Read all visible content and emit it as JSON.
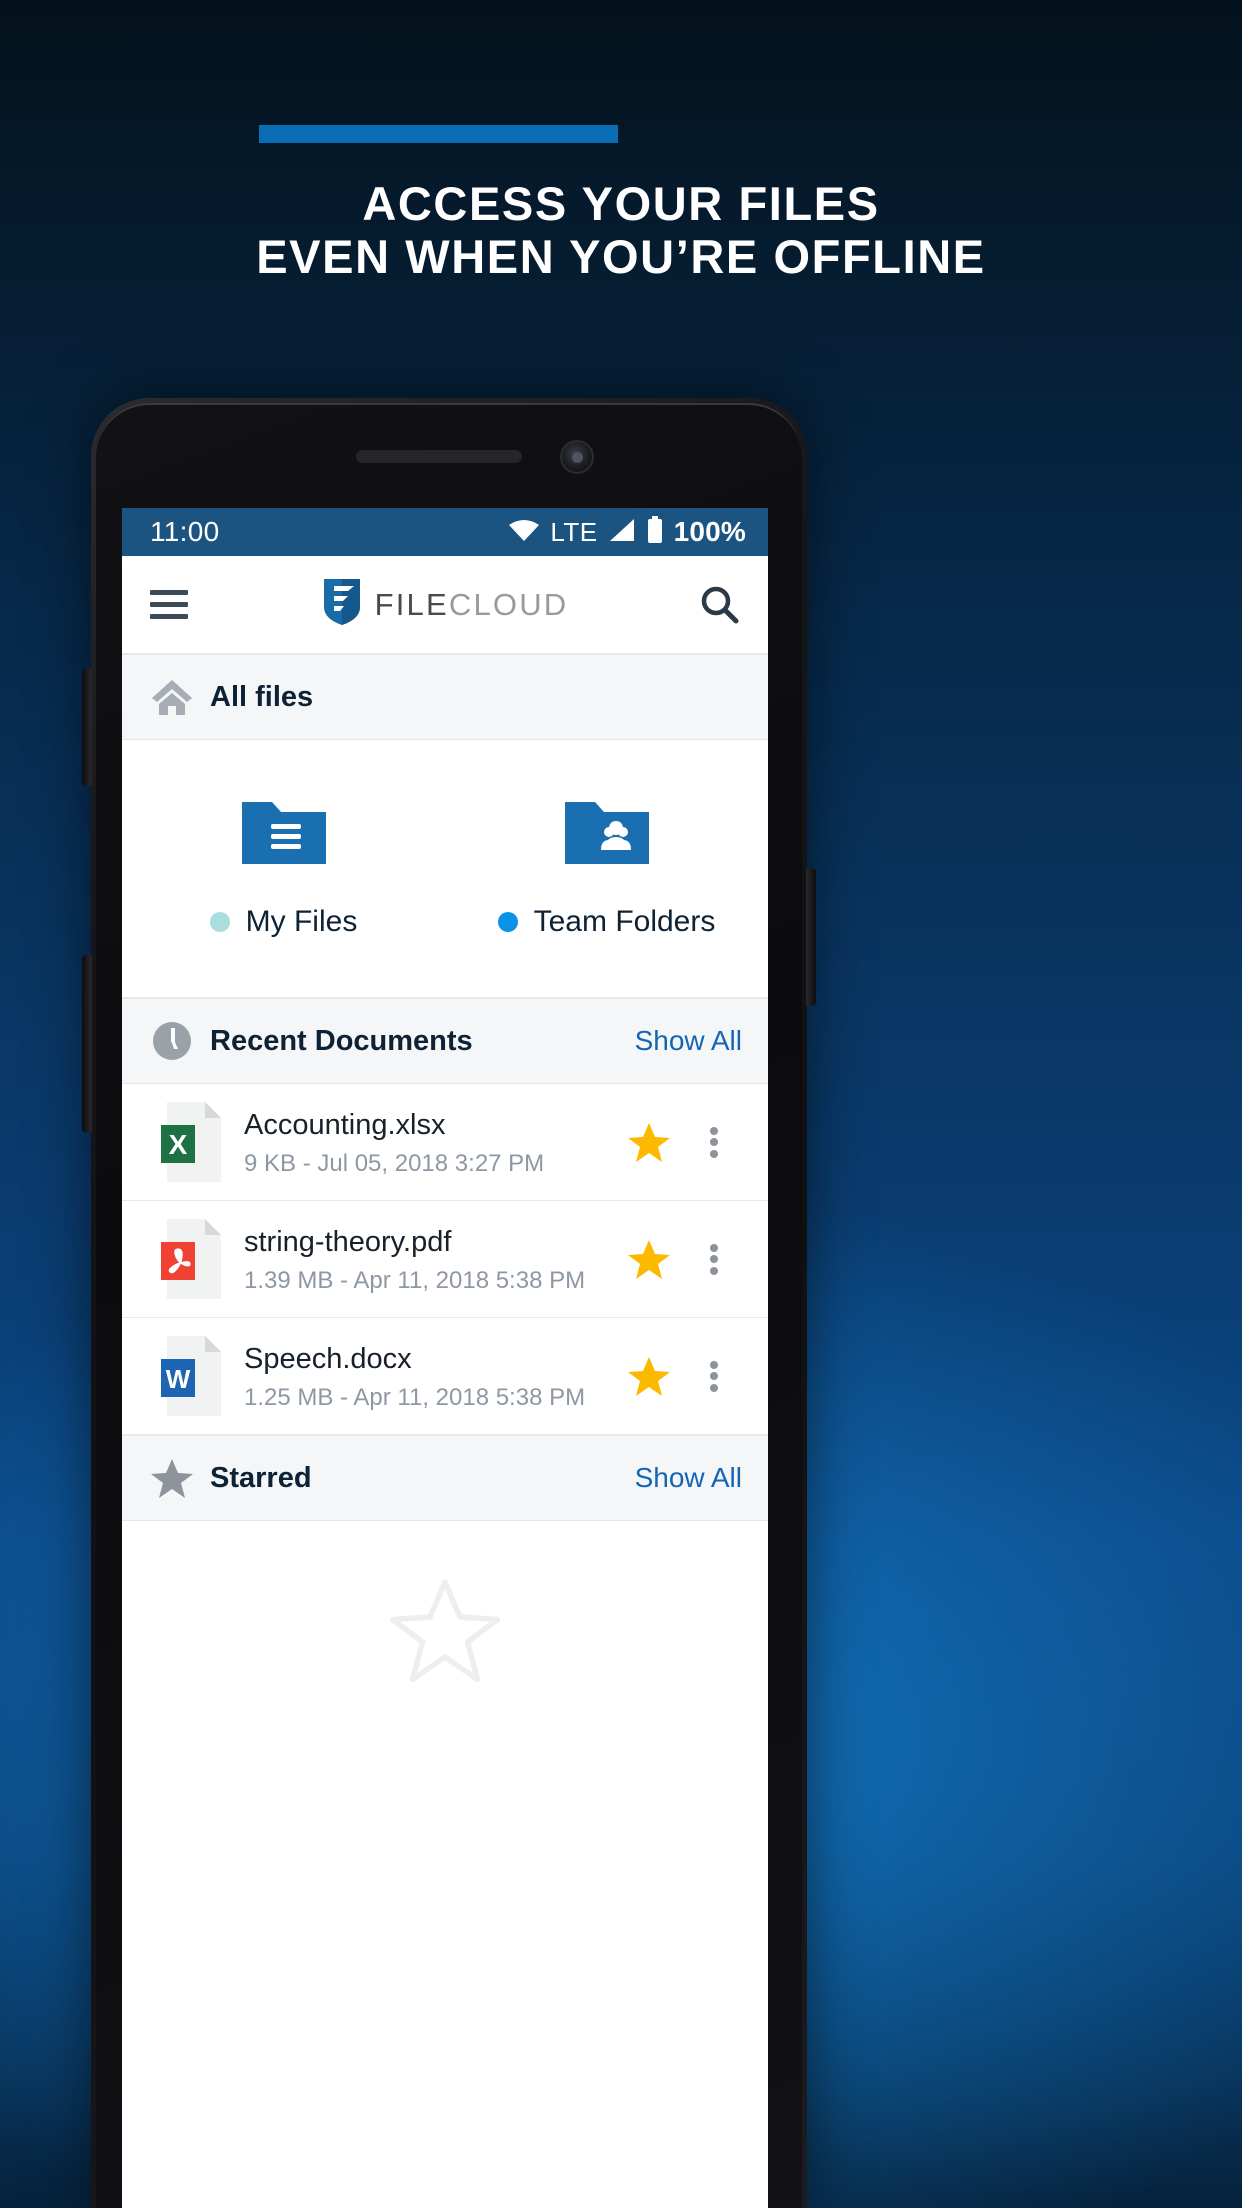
{
  "promo": {
    "accent_bar_color": "#0b6db5",
    "headline_line1": "ACCESS YOUR FILES",
    "headline_line2": "EVEN WHEN YOU’RE OFFLINE"
  },
  "statusbar": {
    "time": "11:00",
    "wifi_icon": "wifi-icon",
    "network_label": "LTE",
    "signal_icon": "signal-icon",
    "battery_icon": "battery-icon",
    "battery_percent": "100%",
    "background_color": "#1b5480"
  },
  "appbar": {
    "menu_icon": "hamburger-menu-icon",
    "logo_icon": "filecloud-shield-icon",
    "brand_part1": "FILE",
    "brand_part2": "CLOUD",
    "search_icon": "search-icon"
  },
  "breadcrumb": {
    "home_icon": "home-icon",
    "label": "All files"
  },
  "folders": [
    {
      "icon": "folder-documents-icon",
      "label": "My Files",
      "dot_color": "#a9ddde"
    },
    {
      "icon": "folder-team-icon",
      "label": "Team Folders",
      "dot_color": "#0b93e8"
    }
  ],
  "recent_section": {
    "icon": "clock-icon",
    "title": "Recent Documents",
    "show_all": "Show All"
  },
  "files": [
    {
      "icon": "excel-file-icon",
      "badge_letter": "X",
      "badge_color": "#1e7145",
      "name": "Accounting.xlsx",
      "meta": "9 KB - Jul 05, 2018 3:27 PM",
      "starred": true,
      "star_color": "#fcb900",
      "overflow_icon": "more-vertical-icon"
    },
    {
      "icon": "pdf-file-icon",
      "badge_letter": "",
      "badge_color": "#f04134",
      "name": "string-theory.pdf",
      "meta": "1.39 MB - Apr 11, 2018 5:38 PM",
      "starred": true,
      "star_color": "#fcb900",
      "overflow_icon": "more-vertical-icon"
    },
    {
      "icon": "word-file-icon",
      "badge_letter": "W",
      "badge_color": "#1d65b3",
      "name": "Speech.docx",
      "meta": "1.25 MB - Apr 11, 2018 5:38 PM",
      "starred": true,
      "star_color": "#fcb900",
      "overflow_icon": "more-vertical-icon"
    }
  ],
  "starred_section": {
    "icon": "star-icon",
    "title": "Starred",
    "show_all": "Show All",
    "empty_icon": "star-outline-icon"
  }
}
